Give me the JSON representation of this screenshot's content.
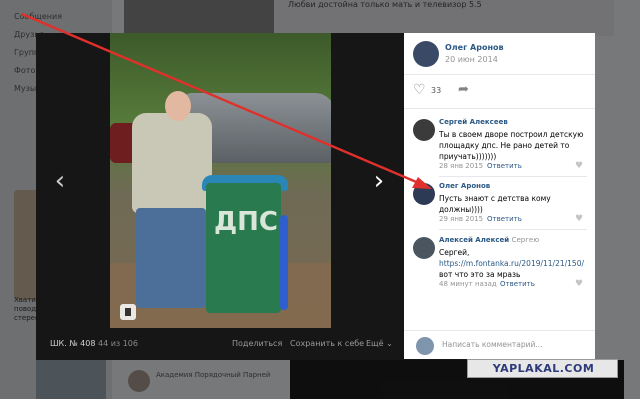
{
  "background": {
    "sidebar_items": [
      "Сообщения",
      "Друзья",
      "Группы",
      "Фото",
      "Музыка"
    ],
    "post_text": "Любви достойна только мать  и телевизор 5.5",
    "left_text": "Хватит жить на поводу у стереотипов!",
    "bottom_item_text": "Академия Порядочный Парней"
  },
  "viewer": {
    "album_label": "ШК. № 408",
    "photo_counter": "44 из 106",
    "share_label": "Поделиться",
    "save_label": "Сохранить к себе",
    "more_label": "Ещё",
    "photo_sign": "ДПС",
    "prev_glyph": "‹",
    "next_glyph": "›"
  },
  "panel": {
    "author": "Олег Аронов",
    "date": "20 июн 2014",
    "likes_count": "33",
    "comments": [
      {
        "name": "Сергей Алексеев",
        "text": "Ты в своем дворе построил детскую площадку дпс. Не рано детей то приучать)))))))",
        "date": "28 янв 2015",
        "reply": "Ответить"
      },
      {
        "name": "Олег Аронов",
        "text": "Пусть знают с детства кому должны))))",
        "date": "29 янв 2015",
        "reply": "Ответить"
      },
      {
        "name": "Алексей Алексей",
        "reply_to": "Сергею",
        "text_prefix": "Сергей, ",
        "link": "https://m.fontanka.ru/2019/11/21/150/",
        "text_suffix": " вот что это за мразь",
        "date": "48 минут назад",
        "reply": "Ответить"
      }
    ],
    "composer_placeholder": "Написать комментарий..."
  },
  "watermark": "YAPLAKAL.COM",
  "colors": {
    "link": "#2a5885",
    "annotation_arrow": "#e0302c"
  }
}
